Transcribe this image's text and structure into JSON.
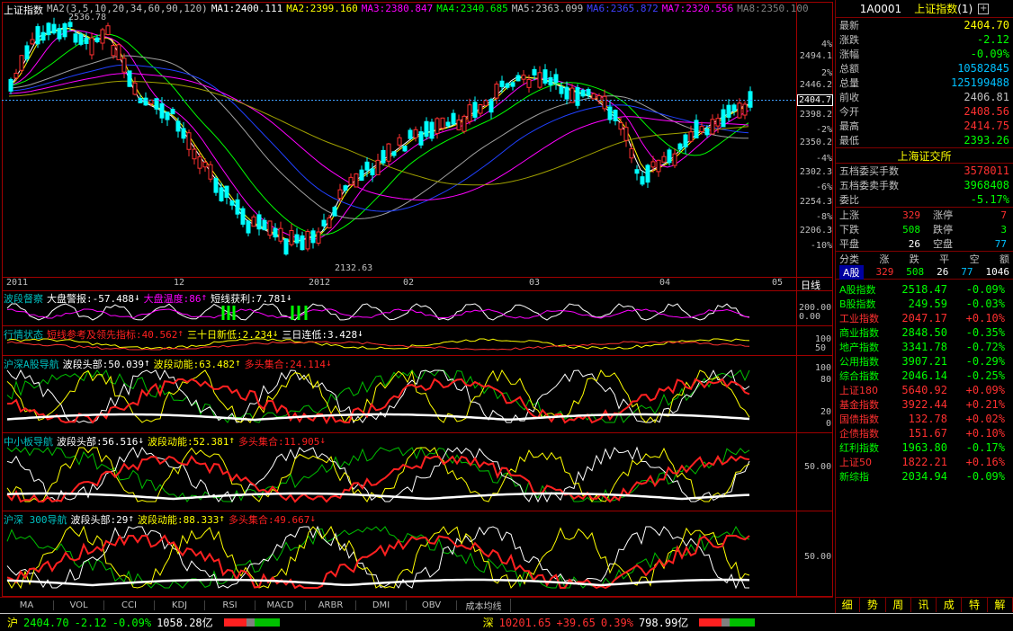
{
  "main_header": {
    "title": "上证指数",
    "ma2": "MA2(3,5,10,20,34,60,90,120)",
    "ma1v": "MA1:2400.111",
    "ma2v": "MA2:2399.160",
    "ma3v": "MA3:2380.847",
    "ma4v": "MA4:2340.685",
    "ma5v": "MA5:2363.099",
    "ma6v": "MA6:2365.872",
    "ma7v": "MA7:2320.556",
    "ma8v": "MA8:2350.100"
  },
  "price_axis": [
    "4%",
    "2494.1",
    "2%",
    "2446.2",
    "2398.2",
    "-2%",
    "2350.2",
    "-4%",
    "2302.3",
    "-6%",
    "2254.3",
    "-8%",
    "2206.3",
    "-10%"
  ],
  "current_price": "2404.7",
  "annot_high": "2536.78",
  "annot_low": "2132.63",
  "date_labels": [
    "2011",
    "12",
    "2012",
    "02",
    "03",
    "04",
    "05"
  ],
  "period_label": "日线",
  "pane2": {
    "title": "波段督察",
    "a": "大盘警报:-57.488",
    "a_arrow": "↓",
    "b": "大盘温度:86",
    "b_arrow": "↑",
    "c": "短线获利:7.781",
    "c_arrow": "↓",
    "axis": [
      "200.00",
      "0.00"
    ]
  },
  "pane3": {
    "title": "行情状态",
    "a": "短线参考及领先指标:40.562",
    "a_arrow": "↑",
    "b": "三十日新低:2.234",
    "b_arrow": "↓",
    "c": "三日连低:3.428",
    "c_arrow": "↓",
    "axis": [
      "100",
      "50"
    ]
  },
  "pane4": {
    "title": "沪深A股导航",
    "a": "波段头部:50.039",
    "a_arrow": "↑",
    "b": "波段动能:63.482",
    "b_arrow": "↑",
    "c": "多头集合:24.114",
    "c_arrow": "↓",
    "axis": [
      "100",
      "80",
      "20",
      "0"
    ]
  },
  "pane5": {
    "title": "中小板导航",
    "a": "波段头部:56.516",
    "a_arrow": "↓",
    "b": "波段动能:52.381",
    "b_arrow": "↑",
    "c": "多头集合:11.905",
    "c_arrow": "↓",
    "axis": [
      "50.00"
    ]
  },
  "pane6": {
    "title": "沪深 300导航",
    "a": "波段头部:29",
    "a_arrow": "↑",
    "b": "波段动能:88.333",
    "b_arrow": "↑",
    "c": "多头集合:49.667",
    "c_arrow": "↓",
    "axis": [
      "50.00"
    ]
  },
  "tabs": [
    "MA",
    "VOL",
    "CCI",
    "KDJ",
    "RSI",
    "MACD",
    "ARBR",
    "DMI",
    "OBV",
    "成本均线"
  ],
  "right": {
    "code": "1A0001",
    "name": "上证指数",
    "name_suffix": "(1)",
    "quote": [
      {
        "k": "最新",
        "v": "2404.70",
        "c": "#ffff00"
      },
      {
        "k": "涨跌",
        "v": "-2.12",
        "c": "#00ff00"
      },
      {
        "k": "涨幅",
        "v": "-0.09%",
        "c": "#00ff00"
      },
      {
        "k": "总额",
        "v": "10582845",
        "c": "#00c0ff"
      },
      {
        "k": "总量",
        "v": "125199488",
        "c": "#00c0ff"
      },
      {
        "k": "前收",
        "v": "2406.81",
        "c": "#c0c0c0"
      },
      {
        "k": "今开",
        "v": "2408.56",
        "c": "#ff3030"
      },
      {
        "k": "最高",
        "v": "2414.75",
        "c": "#ff3030"
      },
      {
        "k": "最低",
        "v": "2393.26",
        "c": "#00ff00"
      }
    ],
    "exchange": "上海证交所",
    "orders": [
      {
        "k": "五档委买手数",
        "v": "3578011",
        "c": "#ff3030"
      },
      {
        "k": "五档委卖手数",
        "v": "3968408",
        "c": "#00ff00"
      },
      {
        "k": "委比",
        "v": "-5.17%",
        "c": "#00ff00"
      }
    ],
    "breadth": [
      {
        "k1": "上涨",
        "v1": "329",
        "c1": "#ff3030",
        "k2": "涨停",
        "v2": "7",
        "c2": "#ff3030"
      },
      {
        "k1": "下跌",
        "v1": "508",
        "c1": "#00ff00",
        "k2": "跌停",
        "v2": "3",
        "c2": "#00ff00"
      },
      {
        "k1": "平盘",
        "v1": "26",
        "c1": "#ffffff",
        "k2": "空盘",
        "v2": "77",
        "c2": "#00c0ff"
      }
    ],
    "cls_header": [
      "分类",
      "涨",
      "跌",
      "平",
      "空",
      "额"
    ],
    "cls_row": {
      "name": "A股",
      "up": "329",
      "down": "508",
      "flat": "26",
      "empty": "77",
      "amt": "1046"
    },
    "indices": [
      {
        "n": "A股指数",
        "v": "2518.47",
        "p": "-0.09%",
        "c": "#00ff00"
      },
      {
        "n": "B股指数",
        "v": "249.59",
        "p": "-0.03%",
        "c": "#00ff00"
      },
      {
        "n": "工业指数",
        "v": "2047.17",
        "p": "+0.10%",
        "c": "#ff3030"
      },
      {
        "n": "商业指数",
        "v": "2848.50",
        "p": "-0.35%",
        "c": "#00ff00"
      },
      {
        "n": "地产指数",
        "v": "3341.78",
        "p": "-0.72%",
        "c": "#00ff00"
      },
      {
        "n": "公用指数",
        "v": "3907.21",
        "p": "-0.29%",
        "c": "#00ff00"
      },
      {
        "n": "综合指数",
        "v": "2046.14",
        "p": "-0.25%",
        "c": "#00ff00"
      },
      {
        "n": "上证180",
        "v": "5640.92",
        "p": "+0.09%",
        "c": "#ff3030"
      },
      {
        "n": "基金指数",
        "v": "3922.44",
        "p": "+0.21%",
        "c": "#ff3030"
      },
      {
        "n": "国债指数",
        "v": "132.78",
        "p": "+0.02%",
        "c": "#ff3030"
      },
      {
        "n": "企债指数",
        "v": "151.67",
        "p": "+0.10%",
        "c": "#ff3030"
      },
      {
        "n": "红利指数",
        "v": "1963.80",
        "p": "-0.17%",
        "c": "#00ff00"
      },
      {
        "n": "上证50",
        "v": "1822.21",
        "p": "+0.16%",
        "c": "#ff3030"
      },
      {
        "n": "新综指",
        "v": "2034.94",
        "p": "-0.09%",
        "c": "#00ff00"
      }
    ],
    "tabs": [
      "细",
      "势",
      "周",
      "讯",
      "成",
      "特",
      "解"
    ]
  },
  "status": {
    "sh_label": "沪",
    "sh_price": "2404.70",
    "sh_chg": "-2.12",
    "sh_pct": "-0.09%",
    "sh_amt": "1058.28亿",
    "sz_label": "深",
    "sz_price": "10201.65",
    "sz_chg": "+39.65",
    "sz_pct": "0.39%",
    "sz_amt": "798.99亿"
  }
}
